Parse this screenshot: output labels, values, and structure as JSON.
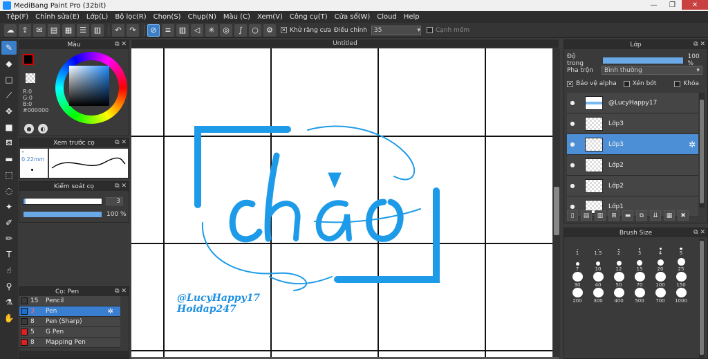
{
  "window": {
    "title": "MediBang Paint Pro (32bit)",
    "min": "—",
    "max": "❐",
    "close": "✕"
  },
  "menu": [
    "Tệp(F)",
    "Chỉnh sửa(E)",
    "Lớp(L)",
    "Bộ lọc(R)",
    "Chọn(S)",
    "Chụp(N)",
    "Màu (C)",
    "Xem(V)",
    "Công cụ(T)",
    "Cửa sổ(W)",
    "Cloud",
    "Help"
  ],
  "toolbar": {
    "antialias_label": "Khử răng cưa",
    "adjust_label": "Điều chỉnh",
    "adjust_value": "35",
    "smooth_label": "Cạnh mềm"
  },
  "color_panel": {
    "title": "Màu",
    "r": "R:0",
    "g": "G:0",
    "b": "B:0",
    "hex": "#000000",
    "fg": "#000000"
  },
  "preview_panel": {
    "title": "Xem trước cọ",
    "size": "° 0.22mm"
  },
  "control_panel": {
    "title": "Kiểm soát cọ",
    "size_value": "3",
    "opacity_value": "100 %",
    "size_fraction": 0.03,
    "opacity_fraction": 1.0
  },
  "brush_panel": {
    "title": "Cọ: Pen",
    "items": [
      {
        "size": "15",
        "name": "Pencil",
        "color": "#3a3a3a",
        "selected": false
      },
      {
        "size": "3",
        "name": "Pen",
        "color": "#1a6fd0",
        "selected": true
      },
      {
        "size": "8",
        "name": "Pen (Sharp)",
        "color": "#3a3a3a",
        "selected": false
      },
      {
        "size": "5",
        "name": "G Pen",
        "color": "#e02020",
        "selected": false
      },
      {
        "size": "8",
        "name": "Mapping Pen",
        "color": "#e02020",
        "selected": false
      }
    ]
  },
  "canvas": {
    "tab_title": "Untitled",
    "art_word": "chào",
    "watermark_line1": "@LucyHappy17",
    "watermark_line2": "Hoidap247",
    "accent": "#1e9be8"
  },
  "layer_panel": {
    "title": "Lớp",
    "opacity_label": "Độ trong",
    "opacity_value": "100 %",
    "blend_label": "Pha trộn",
    "blend_value": "Bình thường",
    "protect_alpha": "Bảo vệ alpha",
    "clipping": "Xén bớt",
    "lock": "Khóa",
    "layers": [
      {
        "name": "@LucyHappy17",
        "selected": false
      },
      {
        "name": "Lớp3",
        "selected": false
      },
      {
        "name": "Lớp3",
        "selected": true
      },
      {
        "name": "Lớp2",
        "selected": false
      },
      {
        "name": "Lớp2",
        "selected": false
      },
      {
        "name": "Lớp1",
        "selected": false
      }
    ]
  },
  "brush_size_panel": {
    "title": "Brush Size",
    "sizes": [
      "1",
      "1.5",
      "2",
      "3",
      "4",
      "5",
      "7",
      "10",
      "12",
      "15",
      "20",
      "25",
      "30",
      "40",
      "50",
      "70",
      "100",
      "150",
      "200",
      "300",
      "400",
      "500",
      "700",
      "1000"
    ]
  }
}
